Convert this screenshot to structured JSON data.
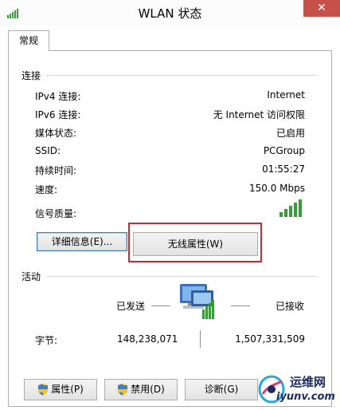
{
  "window": {
    "title": "WLAN 状态",
    "close_label": "✕"
  },
  "tabs": [
    {
      "label": "常规"
    }
  ],
  "connection": {
    "section_title": "连接",
    "rows": [
      {
        "label": "IPv4 连接:",
        "value": "Internet"
      },
      {
        "label": "IPv6 连接:",
        "value": "无 Internet 访问权限"
      },
      {
        "label": "媒体状态:",
        "value": "已启用"
      },
      {
        "label": "SSID:",
        "value": "PCGroup"
      },
      {
        "label": "持续时间:",
        "value": "01:55:27"
      },
      {
        "label": "速度:",
        "value": "150.0 Mbps"
      },
      {
        "label": "信号质量:",
        "value": ""
      }
    ],
    "signal_bars": 5,
    "details_button": "详细信息(E)...",
    "wireless_props_button": "无线属性(W)"
  },
  "activity": {
    "section_title": "活动",
    "sent_label": "已发送",
    "received_label": "已接收",
    "bytes_label": "字节:",
    "bytes_sent": "148,238,071",
    "bytes_received": "1,507,331,509"
  },
  "buttons": {
    "properties": "属性(P)",
    "disable": "禁用(D)",
    "diagnose": "诊断(G)"
  },
  "watermark": {
    "cn": "运维网",
    "url": "iyunv.com"
  },
  "colors": {
    "close_red": "#c7504b",
    "highlight_red": "#d0262c",
    "signal_green": "#3a9a3a"
  }
}
